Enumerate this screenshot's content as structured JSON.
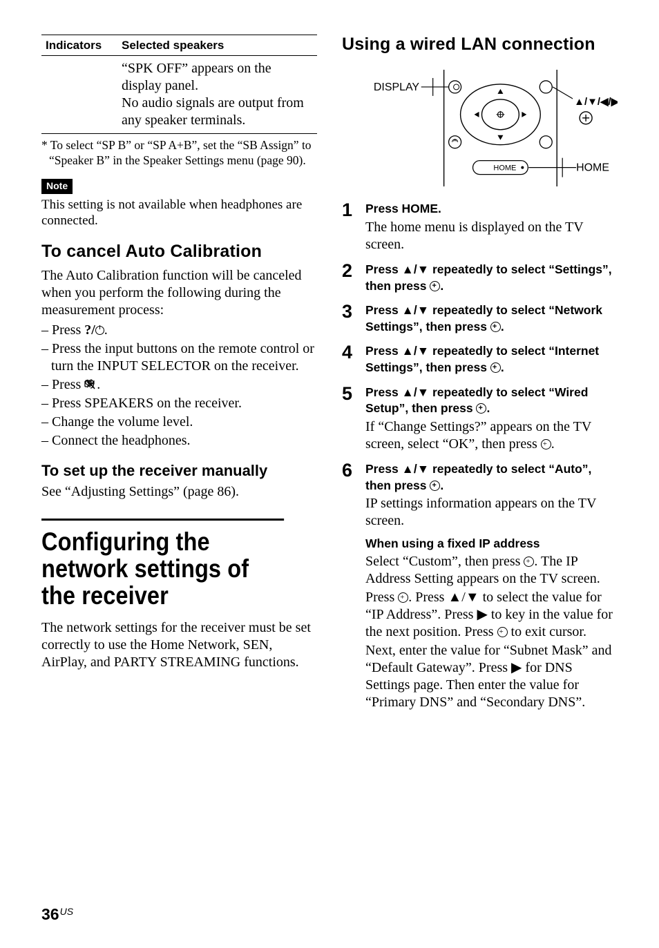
{
  "left": {
    "table": {
      "header_ind": "Indicators",
      "header_sel": "Selected speakers",
      "row_ind": "",
      "row_sel": "“SPK OFF” appears on the display panel.\nNo audio signals are output from any speaker terminals."
    },
    "footnote": "* To select “SP B” or “SP A+B”, set the “SB Assign” to “Speaker B” in the Speaker Settings menu (page 90).",
    "note_label": "Note",
    "note_body": "This setting is not available when headphones are connected.",
    "h_cancel": "To cancel Auto Calibration",
    "cancel_intro": "The Auto Calibration function will be canceled when you perform the following during the measurement process:",
    "cancel_items": [
      "Press ",
      "Press the input buttons on the remote control or turn the INPUT SELECTOR on the receiver.",
      "Press ",
      "Press SPEAKERS on the receiver.",
      "Change the volume level.",
      "Connect the headphones."
    ],
    "power_label": "?/1",
    "h_manual": "To set up the receiver manually",
    "manual_body": "See “Adjusting Settings” (page 86).",
    "h_big": "Configuring the network settings of the receiver",
    "big_body": "The network settings for the receiver must be set correctly to use the Home Network, SEN, AirPlay, and PARTY STREAMING functions."
  },
  "right": {
    "h_wired": "Using a wired LAN connection",
    "diagram": {
      "display": "DISPLAY",
      "home_btn": "HOME",
      "home_label": "HOME",
      "arrows_label": "V/v/B/b,"
    },
    "steps": [
      {
        "num": "1",
        "head": "Press HOME.",
        "detail": "The home menu is displayed on the TV screen."
      },
      {
        "num": "2",
        "head": "Press V/v repeatedly to select “Settings”, then press  ."
      },
      {
        "num": "3",
        "head": "Press V/v repeatedly to select “Network Settings”, then press  ."
      },
      {
        "num": "4",
        "head": "Press V/v repeatedly to select “Internet Settings”, then press  ."
      },
      {
        "num": "5",
        "head": "Press V/v repeatedly to select “Wired Setup”, then press  .",
        "detail": "If “Change Settings?” appears on the TV screen, select “OK”, then press  ."
      },
      {
        "num": "6",
        "head": "Press V/v repeatedly to select “Auto”, then press  .",
        "detail": "IP settings information appears on the TV screen.",
        "subhead": "When using a fixed IP address",
        "sub_detail1": "Select “Custom”, then press  . The IP Address Setting appears on the TV screen.",
        "sub_detail2": "Press  . Press V/v to select the value for “IP Address”. Press b to key in the value for the next position. Press   to exit cursor.",
        "sub_detail3": "Next, enter the value for “Subnet Mask” and “Default Gateway”. Press b for DNS Settings page. Then enter the value for “Primary DNS” and “Secondary DNS”."
      }
    ]
  },
  "page": "36",
  "region": "US"
}
